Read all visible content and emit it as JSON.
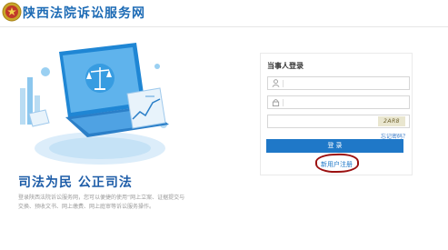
{
  "header": {
    "site_title": "陕西法院诉讼服务网",
    "emblem_icon": "court-emblem-icon"
  },
  "intro": {
    "slogan": "司法为民 公正司法",
    "description_line1": "登录陕西法院诉讼服务网，您可以便捷的使用“网上立案、证据提交与",
    "description_line2": "交换、预收文书、网上缴费、网上庭审等诉讼服务操作。"
  },
  "login": {
    "panel_title": "当事人登录",
    "username": {
      "icon": "user-icon",
      "value": "",
      "placeholder": ""
    },
    "password": {
      "icon": "lock-icon",
      "value": "",
      "placeholder": ""
    },
    "captcha": {
      "value": "",
      "placeholder": "",
      "image_text": "2AR8"
    },
    "forgot_label": "忘记密码？",
    "login_label": "登 录",
    "register_label": "新用户注册"
  },
  "colors": {
    "brand": "#1d6bb5",
    "button": "#1f78c8",
    "annotation": "#9b1010"
  }
}
